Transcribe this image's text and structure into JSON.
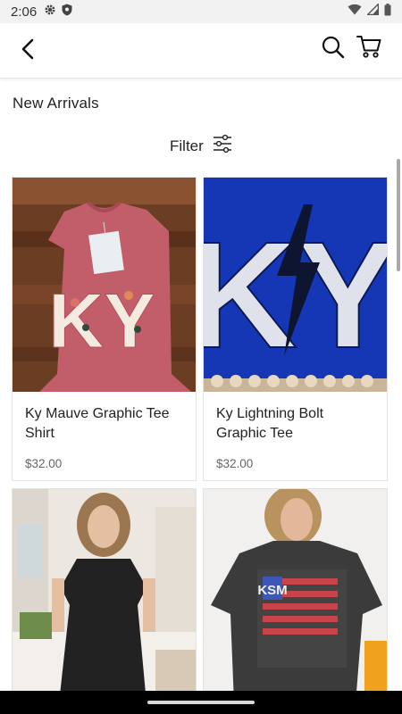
{
  "status_bar": {
    "time": "2:06"
  },
  "header": {
    "back_icon": "chevron-left-icon",
    "search_icon": "search-icon",
    "cart_icon": "cart-icon"
  },
  "section": {
    "title": "New Arrivals"
  },
  "filter": {
    "label": "Filter",
    "icon": "sliders-icon"
  },
  "products": [
    {
      "name": "Ky Mauve Graphic Tee Shirt",
      "price": "$32.00",
      "image_text": "KY",
      "image": "mauve-ky-tee-photo"
    },
    {
      "name": "Ky Lightning Bolt Graphic Tee",
      "price": "$32.00",
      "image_text": "KY",
      "image": "blue-ky-lightning-tee-photo"
    },
    {
      "name": "",
      "price": "",
      "image": "black-dress-photo"
    },
    {
      "name": "",
      "price": "",
      "image_text": "KSM",
      "image": "acid-wash-flag-tee-photo"
    }
  ],
  "colors": {
    "mauve": "#c25e6a",
    "royal_blue": "#1537b5",
    "wood": "#6b3d22",
    "charcoal": "#3b3b3b"
  }
}
